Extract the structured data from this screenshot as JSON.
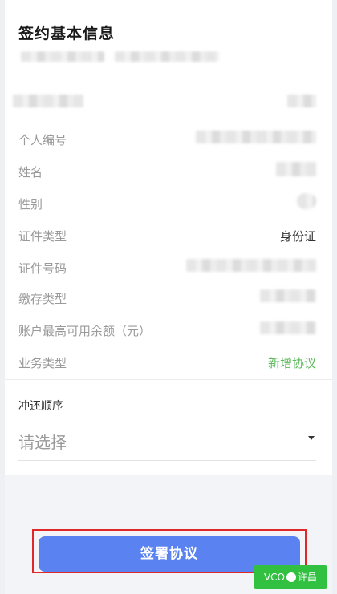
{
  "header": {
    "title": "签约基本信息"
  },
  "info_rows": [
    {
      "label": "个人编号",
      "value": ""
    },
    {
      "label": "姓名",
      "value": ""
    },
    {
      "label": "性别",
      "value": ""
    },
    {
      "label": "证件类型",
      "value": "身份证"
    },
    {
      "label": "证件号码",
      "value": ""
    },
    {
      "label": "缴存类型",
      "value": ""
    },
    {
      "label": "账户最高可用余额（元）",
      "value": ""
    },
    {
      "label": "业务类型",
      "value": "新增协议"
    }
  ],
  "order": {
    "label": "冲还顺序",
    "placeholder": "请选择"
  },
  "actions": {
    "sign_label": "签署协议"
  },
  "watermark": {
    "text_left": "VCO",
    "text_right": "许昌"
  },
  "colors": {
    "primary_button": "#5a82f0",
    "highlight_value": "#5cb85c",
    "annotation_frame": "#e0282a"
  }
}
